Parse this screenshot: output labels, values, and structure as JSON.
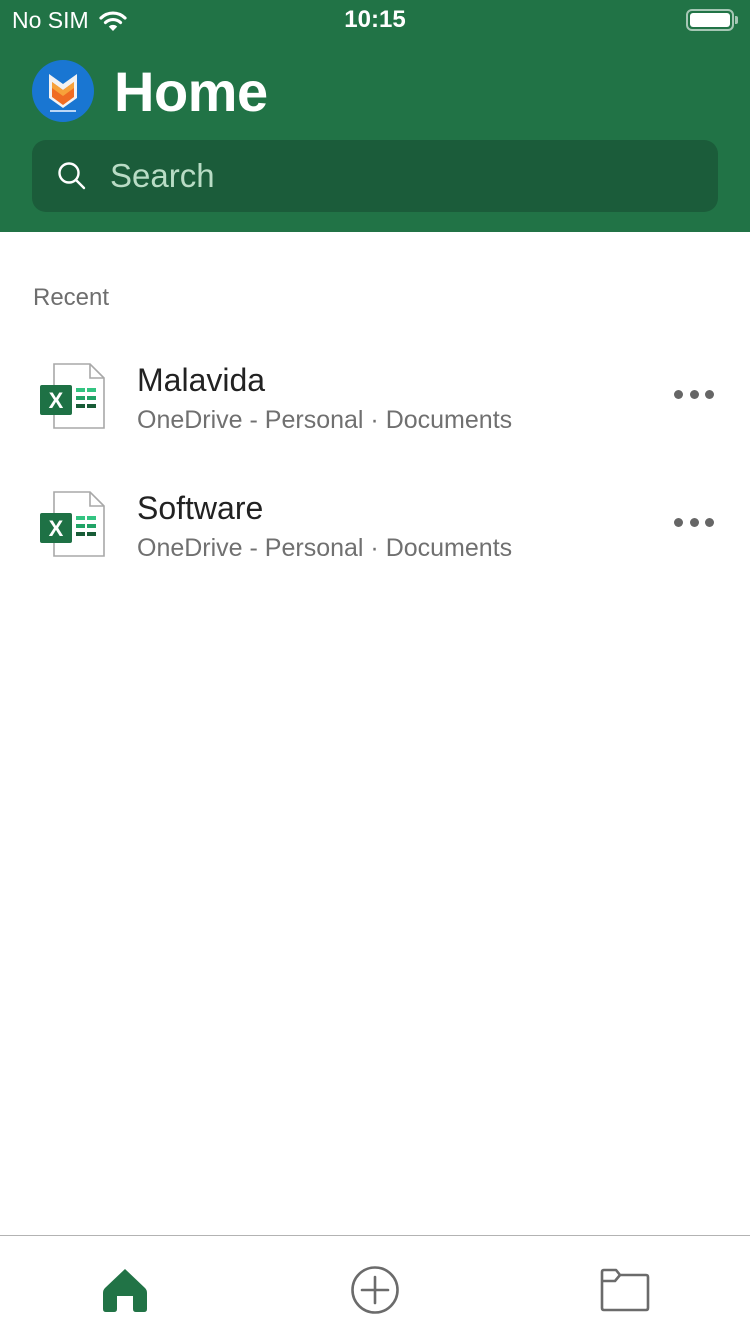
{
  "status_bar": {
    "carrier": "No SIM",
    "time": "10:15",
    "wifi_icon": "wifi-icon",
    "battery_icon": "battery-full-icon",
    "battery_level_percent": 100
  },
  "header": {
    "title": "Home",
    "avatar_icon": "malavida-logo",
    "background_color": "#217346"
  },
  "search": {
    "placeholder": "Search",
    "value": "",
    "icon": "search-icon"
  },
  "recent": {
    "label": "Recent",
    "items": [
      {
        "name": "Malavida",
        "location": "OneDrive - Personal · Documents",
        "icon": "excel-file-icon"
      },
      {
        "name": "Software",
        "location": "OneDrive - Personal · Documents",
        "icon": "excel-file-icon"
      }
    ]
  },
  "tabbar": {
    "tabs": [
      {
        "id": "home",
        "icon": "home-icon",
        "active": true
      },
      {
        "id": "new",
        "icon": "add-circle-icon",
        "active": false
      },
      {
        "id": "open",
        "icon": "folder-icon",
        "active": false
      }
    ],
    "active_color": "#217346",
    "inactive_color": "#6b6b6b"
  }
}
